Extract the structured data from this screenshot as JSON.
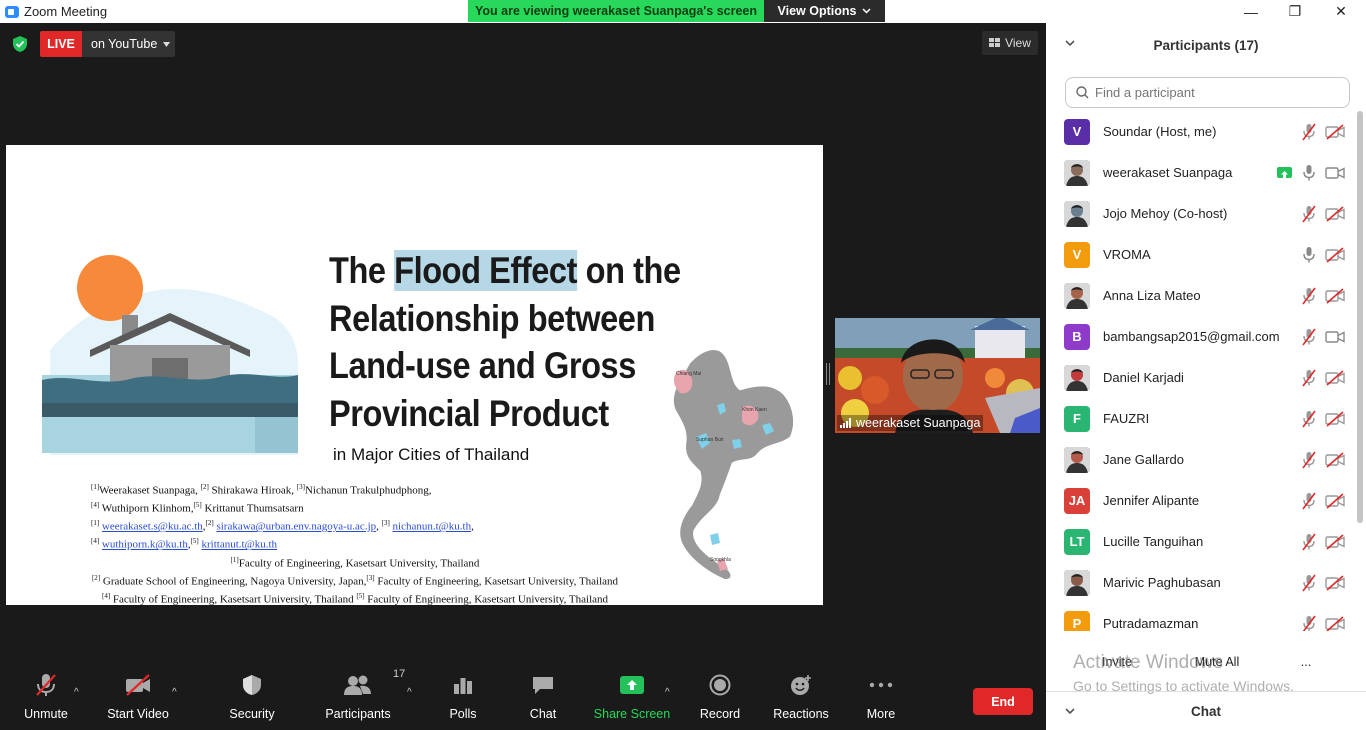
{
  "window": {
    "title": "Zoom Meeting",
    "minimize": "—",
    "maximize": "❐",
    "close": "✕"
  },
  "share_banner": {
    "text": "You are viewing weerakaset Suanpaga's screen",
    "view_options": "View Options"
  },
  "meeting": {
    "live_label": "LIVE",
    "live_target": "on YouTube",
    "view_label": "View"
  },
  "slide": {
    "title_pre": "The ",
    "title_highlight": "Flood Effect",
    "title_line1_post": " on the",
    "title_line2": "Relationship between",
    "title_line3": "Land-use and Gross",
    "title_line4": "Provincial Product",
    "subtitle": "in Major Cities of Thailand",
    "authors_line1": "Weerakaset Suanpaga, ",
    "authors_line1b": " Shirakawa Hiroak, ",
    "authors_line1c": "Nichanun Trakulphudphong,",
    "authors_line2": "Wuthiporn Klinhom,",
    "authors_line2b": " Krittanut Thumsatsarn",
    "email1": "weerakaset.s@ku.ac.th",
    "email2": "sirakawa@urban.env.nagoya-u.ac.jp",
    "email3": "nichanun.t@ku.th",
    "email4": "wuthiporn.k@ku.th",
    "email5": "krittanut.t@ku.th",
    "affil1": "Faculty of Engineering, Kasetsart University, Thailand",
    "affil2a": "Graduate School of Engineering, Nagoya University, Japan,",
    "affil2b": "Faculty of Engineering, Kasetsart University, Thailand",
    "affil3a": "Faculty of Engineering, Kasetsart University, Thailand ",
    "affil3b": "Faculty of Engineering, Kasetsart University, Thailand",
    "sup1": "[1]",
    "sup2": "[2]",
    "sup3": "[3]",
    "sup4": "[4]",
    "sup5": "[5]",
    "map_labels": [
      "Chiang Mai",
      "Khon Kaen",
      "Suphan Buri",
      "Songkhla"
    ]
  },
  "video": {
    "name": "weerakaset Suanpaga"
  },
  "toolbar": {
    "unmute": "Unmute",
    "start_video": "Start Video",
    "security": "Security",
    "participants": "Participants",
    "participants_count": "17",
    "polls": "Polls",
    "chat": "Chat",
    "share_screen": "Share Screen",
    "record": "Record",
    "reactions": "Reactions",
    "more": "More",
    "end": "End"
  },
  "panel": {
    "title": "Participants (17)",
    "search_placeholder": "Find a participant",
    "participants": [
      {
        "name": "Soundar (Host, me)",
        "initials": "V",
        "color": "#5a2ea6",
        "mic": "muted",
        "cam": "off"
      },
      {
        "name": "weerakaset Suanpaga",
        "initials": "",
        "color": "#8a6d5a",
        "mic": "on",
        "cam": "on",
        "sharing": true
      },
      {
        "name": "Jojo Mehoy (Co-host)",
        "initials": "",
        "color": "#6b7f8f",
        "mic": "muted",
        "cam": "off"
      },
      {
        "name": "VROMA",
        "initials": "V",
        "color": "#f29b0c",
        "mic": "on",
        "cam": "off"
      },
      {
        "name": "Anna Liza Mateo",
        "initials": "",
        "color": "#a6634a",
        "mic": "muted",
        "cam": "off"
      },
      {
        "name": "bambangsap2015@gmail.com",
        "initials": "B",
        "color": "#8e3bc9",
        "mic": "muted",
        "cam": "on"
      },
      {
        "name": "Daniel Karjadi",
        "initials": "",
        "color": "#c23b3b",
        "mic": "muted",
        "cam": "off"
      },
      {
        "name": "FAUZRI",
        "initials": "F",
        "color": "#2bb573",
        "mic": "muted",
        "cam": "off"
      },
      {
        "name": "Jane Gallardo",
        "initials": "",
        "color": "#b35a4a",
        "mic": "muted",
        "cam": "off"
      },
      {
        "name": "Jennifer Alipante",
        "initials": "JA",
        "color": "#d9403a",
        "mic": "muted",
        "cam": "off"
      },
      {
        "name": "Lucille Tanguihan",
        "initials": "LT",
        "color": "#2bb573",
        "mic": "muted",
        "cam": "off"
      },
      {
        "name": "Marivic Paghubasan",
        "initials": "",
        "color": "#8a5b4a",
        "mic": "muted",
        "cam": "off"
      },
      {
        "name": "Putradamazman",
        "initials": "P",
        "color": "#f29b0c",
        "mic": "muted",
        "cam": "off"
      }
    ],
    "invite": "Invite",
    "mute_all": "Mute All",
    "more": "...",
    "activate_title": "Activate Windows",
    "activate_sub": "Go to Settings to activate Windows.",
    "chat": "Chat"
  },
  "colors": {
    "accent": "#2d8cff",
    "live_red": "#e02828",
    "share_green": "#27d85a",
    "muted_red": "#e02828"
  }
}
